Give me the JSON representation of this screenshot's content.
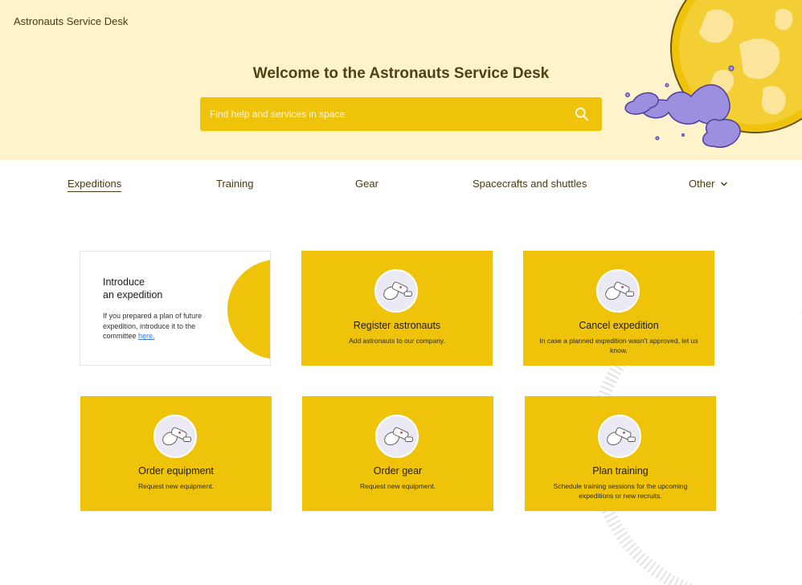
{
  "app": {
    "brand": "Astronauts Service Desk"
  },
  "hero": {
    "title": "Welcome to the Astronauts Service Desk",
    "search_placeholder": "Find help and services in space"
  },
  "nav": {
    "items": [
      "Expeditions",
      "Training",
      "Gear",
      "Spacecrafts and shuttles",
      "Other"
    ],
    "active": "Expeditions"
  },
  "intro_card": {
    "title_line1": "Introduce",
    "title_line2": "an expedition",
    "desc": "If you prepared a plan of future expedition, introduce it to the committee ",
    "link": "here."
  },
  "cards": [
    {
      "title": "Register astronauts",
      "desc": "Add astronauts to our company."
    },
    {
      "title": "Cancel expedition",
      "desc": "In case a planned expedition wasn't approved, let us know."
    },
    {
      "title": "Order equipment",
      "desc": "Request new equipment."
    },
    {
      "title": "Order gear",
      "desc": "Request new equipment."
    },
    {
      "title": "Plan training",
      "desc": "Schedule training sessions for the upcoming expeditions or new recruits."
    }
  ],
  "colors": {
    "hero_bg": "#fff3cc",
    "accent": "#f0c30b",
    "heading": "#4b4412",
    "link": "#3d73d6"
  },
  "icons": [
    "search-icon",
    "chevron-down-icon",
    "astronaut-icon",
    "planet-illustration"
  ]
}
